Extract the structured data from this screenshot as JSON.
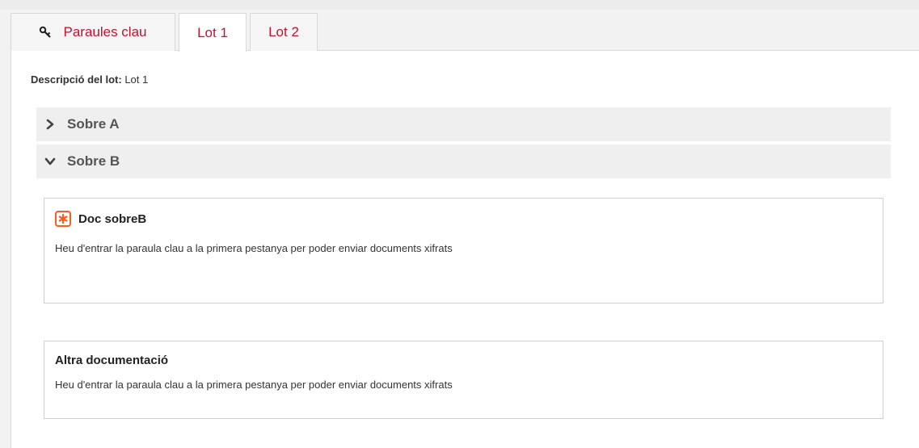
{
  "tabs": [
    {
      "label": "Paraules clau",
      "icon": "key-icon",
      "active": false
    },
    {
      "label": "Lot 1",
      "active": true
    },
    {
      "label": "Lot 2",
      "active": false
    }
  ],
  "lot_description": {
    "label": "Descripció del lot:",
    "value": "Lot 1"
  },
  "envelopes": [
    {
      "title": "Sobre A",
      "expanded": false,
      "icon": "chevron-right-icon"
    },
    {
      "title": "Sobre B",
      "expanded": true,
      "icon": "chevron-down-icon"
    }
  ],
  "documents": [
    {
      "title": "Doc sobreB",
      "required": true,
      "icon": "required-asterisk-icon",
      "message": "Heu d'entrar la paraula clau a la primera pestanya per poder enviar documents xifrats"
    },
    {
      "title": "Altra documentació",
      "required": false,
      "message": "Heu d'entrar la paraula clau a la primera pestanya per poder enviar documents xifrats"
    }
  ],
  "colors": {
    "accent": "#c8102e",
    "required_icon": "#ff5a1f"
  }
}
